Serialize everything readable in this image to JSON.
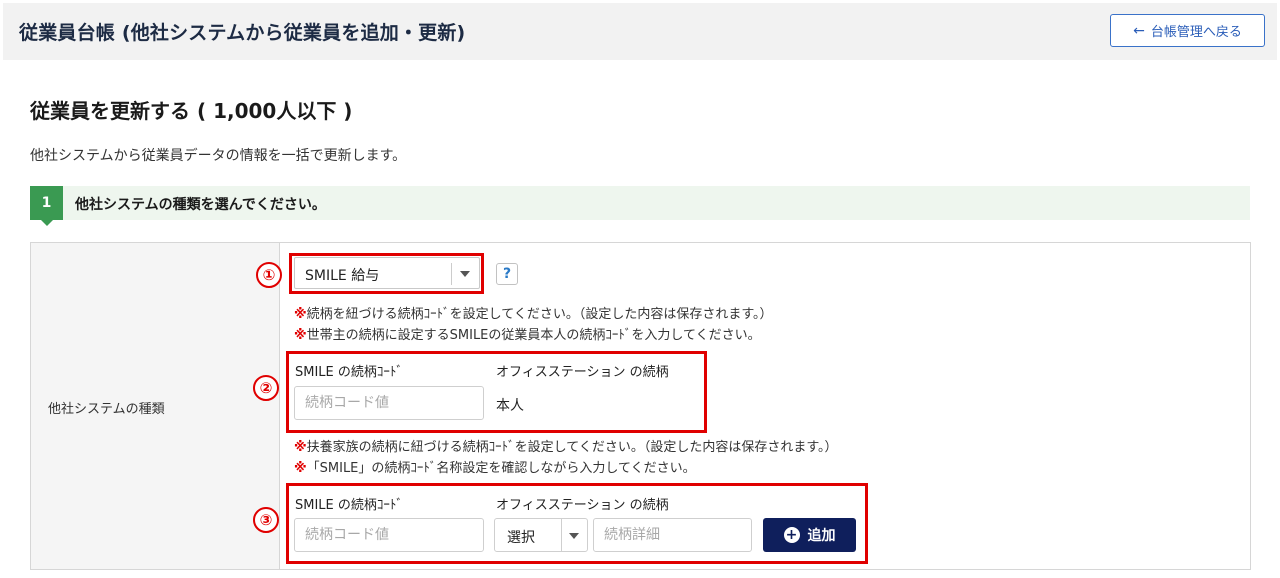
{
  "header": {
    "title": "従業員台帳 (他社システムから従業員を追加・更新)",
    "back_button": "台帳管理へ戻る"
  },
  "main": {
    "heading": "従業員を更新する ( 1,000人以下 )",
    "description": "他社システムから従業員データの情報を一括で更新します。",
    "step": {
      "number": "1",
      "text": "他社システムの種類を選んでください。"
    },
    "form": {
      "row_label": "他社システムの種類",
      "system_select": {
        "value": "SMILE 給与"
      },
      "help_label": "?",
      "notes_head": [
        {
          "mark": "※",
          "text": "続柄を紐づける続柄ｺｰﾄﾞを設定してください。（設定した内容は保存されます。）"
        },
        {
          "mark": "※",
          "text": "世帯主の続柄に設定するSMILEの従業員本人の続柄ｺｰﾄﾞを入力してください。"
        }
      ],
      "head_mapping": {
        "smile_col_label": "SMILE の続柄ｺｰﾄﾞ",
        "office_col_label": "オフィスステーション の続柄",
        "code_placeholder": "続柄コード値",
        "office_value": "本人"
      },
      "notes_family": [
        {
          "mark": "※",
          "text": "扶養家族の続柄に紐づける続柄ｺｰﾄﾞを設定してください。（設定した内容は保存されます。）"
        },
        {
          "mark": "※",
          "text": "「SMILE」の続柄ｺｰﾄﾞ名称設定を確認しながら入力してください。"
        }
      ],
      "family_mapping": {
        "smile_col_label": "SMILE の続柄ｺｰﾄﾞ",
        "office_col_label": "オフィスステーション の続柄",
        "code_placeholder": "続柄コード値",
        "select_value": "選択",
        "detail_placeholder": "続柄詳細",
        "add_button": "追加"
      }
    }
  },
  "annotations": [
    "①",
    "②",
    "③"
  ],
  "colors": {
    "accent_red": "#e00000",
    "step_green": "#3a9a52",
    "add_button_navy": "#0f1f5c",
    "link_blue": "#2a5db8"
  },
  "icons": {
    "back": "arrow-left-icon",
    "dropdown": "chevron-down-icon",
    "help": "question-icon",
    "add": "plus-circle-icon"
  }
}
